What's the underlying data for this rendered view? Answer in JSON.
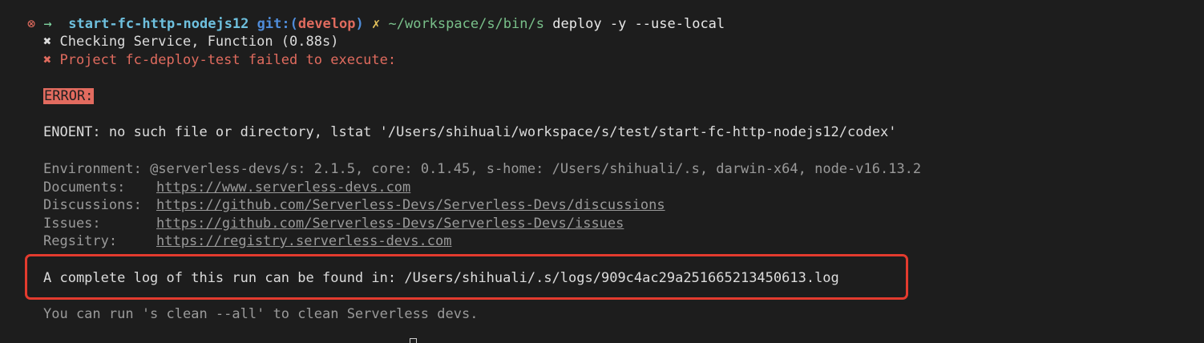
{
  "prompt": {
    "status_icon": "⊗",
    "arrow": "→",
    "directory": "start-fc-http-nodejs12",
    "git_label": "git:(",
    "branch": "develop",
    "git_close": ")",
    "dirty_mark": "✗",
    "path": "~/workspace/s/bin/s",
    "command": "deploy -y --use-local"
  },
  "output": {
    "check_line": "✖ Checking Service, Function (0.88s)",
    "fail_line": "✖ Project fc-deploy-test failed to execute:",
    "error_label": "ERROR:",
    "error_message": "ENOENT: no such file or directory, lstat '/Users/shihuali/workspace/s/test/start-fc-http-nodejs12/codex'",
    "environment": {
      "label": "Environment:",
      "value": "@serverless-devs/s: 2.1.5, core: 0.1.45, s-home: /Users/shihuali/.s, darwin-x64, node-v16.13.2"
    },
    "documents": {
      "label": "Documents:",
      "value": "https://www.serverless-devs.com"
    },
    "discussions": {
      "label": "Discussions:",
      "value": "https://github.com/Serverless-Devs/Serverless-Devs/discussions"
    },
    "issues": {
      "label": "Issues:",
      "value": "https://github.com/Serverless-Devs/Serverless-Devs/issues"
    },
    "registry": {
      "label": "Regsitry:",
      "value": "https://registry.serverless-devs.com"
    },
    "log_line": "A complete log of this run can be found in: /Users/shihuali/.s/logs/909c4ac29a251665213450613.log",
    "clean_line": "You can run 's clean --all' to clean Serverless devs."
  },
  "colors": {
    "background": "#1d1d1d",
    "error_red": "#e06b5e",
    "highlight_box": "#e33b2e",
    "directory_cyan": "#6ec0de",
    "path_green": "#79c08a"
  }
}
